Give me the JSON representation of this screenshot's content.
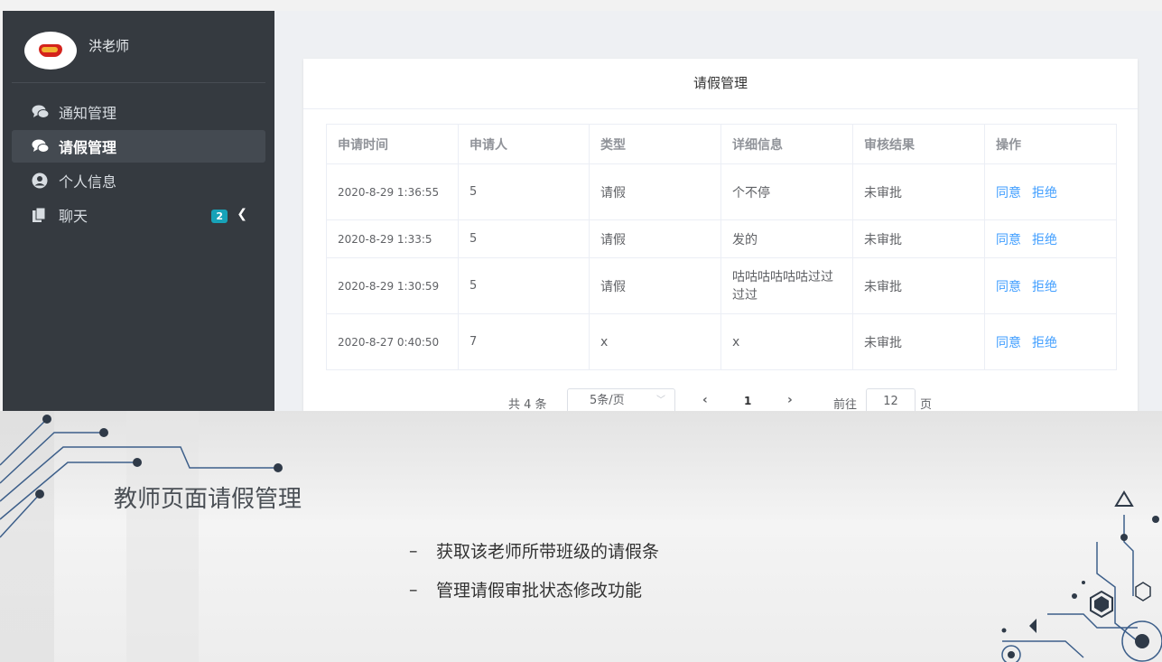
{
  "sidebar": {
    "username": "洪老师",
    "items": [
      {
        "label": "通知管理",
        "icon": "comments-icon",
        "active": false
      },
      {
        "label": "请假管理",
        "icon": "comments-icon",
        "active": true
      },
      {
        "label": "个人信息",
        "icon": "user-circle-icon",
        "active": false
      },
      {
        "label": "聊天",
        "icon": "copy-icon",
        "active": false,
        "badge": "2"
      }
    ]
  },
  "card": {
    "title": "请假管理"
  },
  "table": {
    "headers": [
      "申请时间",
      "申请人",
      "类型",
      "详细信息",
      "审核结果",
      "操作"
    ],
    "rows": [
      {
        "time": "2020-8-29 1:36:55",
        "applicant": "5",
        "type": "请假",
        "detail": "个不停",
        "result": "未审批",
        "agree": "同意",
        "reject": "拒绝"
      },
      {
        "time": "2020-8-29 1:33:5",
        "applicant": "5",
        "type": "请假",
        "detail": "发的",
        "result": "未审批",
        "agree": "同意",
        "reject": "拒绝"
      },
      {
        "time": "2020-8-29 1:30:59",
        "applicant": "5",
        "type": "请假",
        "detail": "咕咕咕咕咕咕过过过过",
        "result": "未审批",
        "agree": "同意",
        "reject": "拒绝"
      },
      {
        "time": "2020-8-27 0:40:50",
        "applicant": "7",
        "type": "x",
        "detail": "x",
        "result": "未审批",
        "agree": "同意",
        "reject": "拒绝"
      }
    ]
  },
  "pagination": {
    "total": "共 4 条",
    "page_size": "5条/页",
    "prev": "‹",
    "current_page": "1",
    "next": "›",
    "goto_label": "前往",
    "goto_value": "12",
    "goto_unit": "页"
  },
  "slide": {
    "title": "教师页面请假管理",
    "bullets": [
      {
        "dash": "–",
        "text": "获取该老师所带班级的请假条"
      },
      {
        "dash": "–",
        "text": "管理请假审批状态修改功能"
      }
    ]
  },
  "colors": {
    "sidebar_bg": "#353a40",
    "link": "#409eff",
    "badge": "#17a2b8",
    "circuit": "#3d5f8a"
  }
}
